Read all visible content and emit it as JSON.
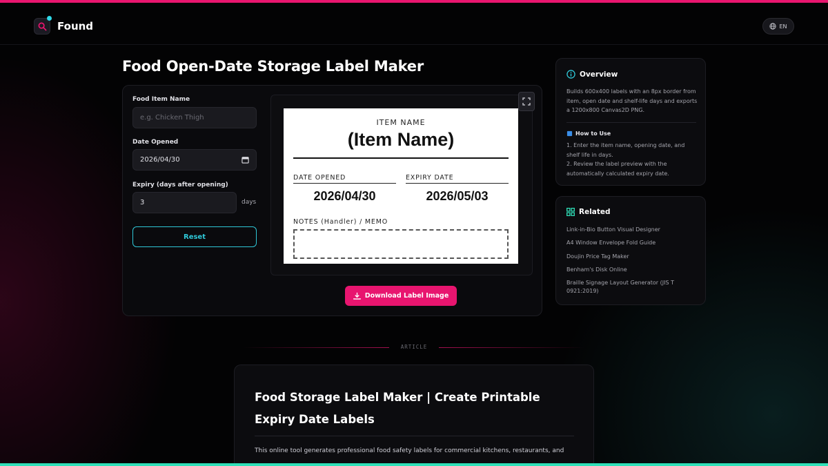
{
  "header": {
    "brand": "Found",
    "lang": "EN"
  },
  "page": {
    "title": "Food Open-Date Storage Label Maker"
  },
  "form": {
    "food_item_label": "Food Item Name",
    "food_item_placeholder": "e.g. Chicken Thigh",
    "date_opened_label": "Date Opened",
    "date_opened_value": "2026/04/30",
    "expiry_label": "Expiry (days after opening)",
    "expiry_value": "3",
    "expiry_unit": "days",
    "reset_label": "Reset"
  },
  "label_preview": {
    "item_caption": "ITEM NAME",
    "item_name": "(Item Name)",
    "date_opened_caption": "DATE OPENED",
    "date_opened": "2026/04/30",
    "expiry_caption": "EXPIRY DATE",
    "expiry_date": "2026/05/03",
    "notes_caption": "NOTES (Handler) / MEMO"
  },
  "actions": {
    "download_label": "Download Label Image"
  },
  "overview": {
    "title": "Overview",
    "description": "Builds 600x400 labels with an 8px border from item, open date and shelf-life days and exports a 1200x800 Canvas2D PNG.",
    "how_to_title": "How to Use",
    "steps": [
      "1. Enter the item name, opening date, and shelf life in days.",
      "2. Review the label preview with the automatically calculated expiry date."
    ]
  },
  "related": {
    "title": "Related",
    "links": [
      "Link-in-Bio Button Visual Designer",
      "A4 Window Envelope Fold Guide",
      "Doujin Price Tag Maker",
      "Benham's Disk Online",
      "Braille Signage Layout Generator (JIS T 0921:2019)"
    ]
  },
  "article": {
    "tag": "ARTICLE",
    "heading": "Food Storage Label Maker | Create Printable Expiry Date Labels",
    "intro": "This online tool generates professional food safety labels for commercial kitchens, restaurants, and"
  },
  "colors": {
    "accent_pink": "#e8156f",
    "accent_cyan": "#2fc8d8",
    "accent_teal": "#2fe0b8",
    "background": "#030304"
  }
}
